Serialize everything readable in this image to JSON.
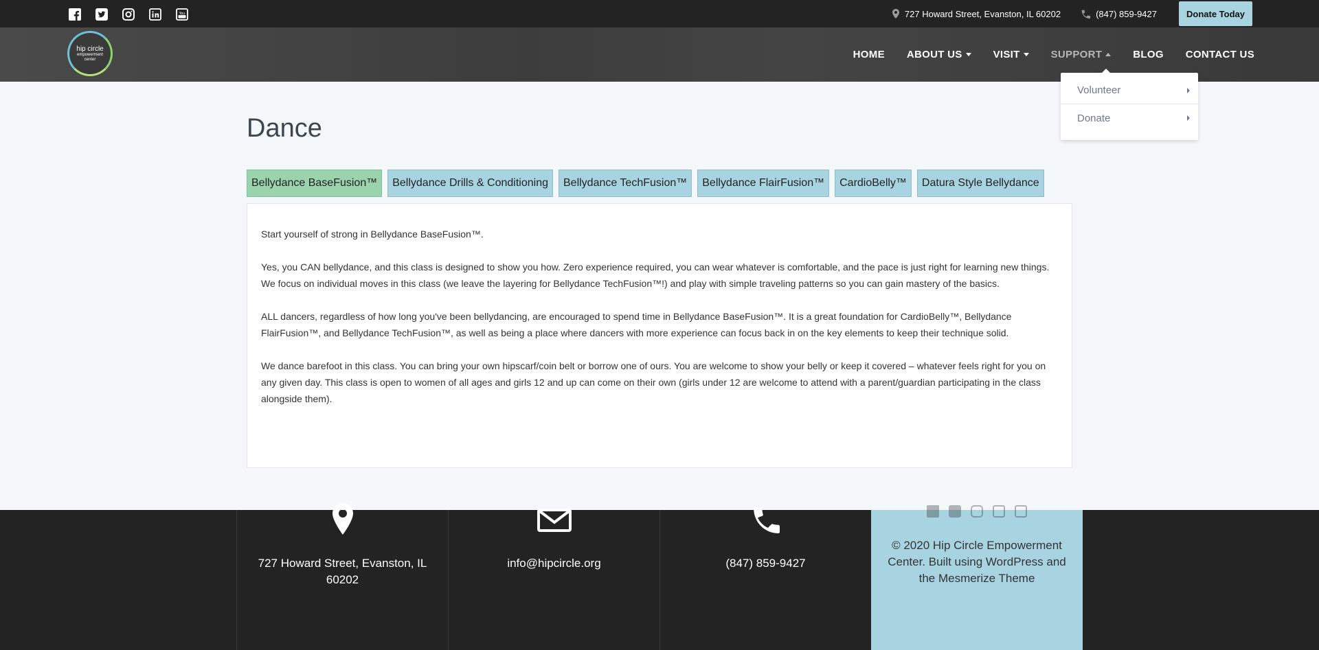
{
  "topbar": {
    "social": [
      "facebook-icon",
      "twitter-icon",
      "instagram-icon",
      "linkedin-icon",
      "youtube-icon"
    ],
    "address": "727 Howard Street, Evanston, IL 60202",
    "phone": "(847) 859-9427",
    "donate_label": "Donate Today"
  },
  "logo": {
    "line1": "hip circle",
    "line2": "empowerment",
    "line3": "center"
  },
  "nav": {
    "items": [
      {
        "label": "HOME",
        "has_caret": false
      },
      {
        "label": "ABOUT US",
        "has_caret": true
      },
      {
        "label": "VISIT",
        "has_caret": true
      },
      {
        "label": "SUPPORT",
        "has_caret": true,
        "active": true
      },
      {
        "label": "BLOG",
        "has_caret": false
      },
      {
        "label": "CONTACT US",
        "has_caret": false
      }
    ],
    "dropdown": [
      "Volunteer",
      "Donate"
    ]
  },
  "main": {
    "title": "Dance",
    "tabs": [
      "Bellydance BaseFusion™",
      "Bellydance Drills & Conditioning",
      "Bellydance TechFusion™",
      "Bellydance FlairFusion™",
      "CardioBelly™",
      "Datura Style Bellydance"
    ],
    "selected_tab": 0,
    "paragraphs": [
      "Start yourself of strong in Bellydance BaseFusion™.",
      "Yes, you CAN bellydance, and this class is designed to show you how. Zero experience required, you can wear whatever is comfortable, and the pace is just right for learning new things. We focus on individual moves in this class (we leave the layering for Bellydance TechFusion™!) and play with simple traveling patterns so you can gain mastery of the basics.",
      "ALL dancers, regardless of how long you've been bellydancing, are encouraged to spend time in Bellydance BaseFusion™. It is a great foundation for CardioBelly™, Bellydance FlairFusion™, and Bellydance TechFusion™, as well as being a place where dancers with more experience can focus back in on the key elements to keep their technique solid.",
      "We dance barefoot in this class. You can bring your own hipscarf/coin belt or borrow one of ours. You are welcome to show your belly or keep it covered – whatever feels right for you on any given day. This class is open to women of all ages and girls 12 and up can come on their own (girls under 12 are welcome to attend with a parent/guardian participating in the class alongside them)."
    ]
  },
  "footer": {
    "address": "727 Howard Street, Evanston, IL 60202",
    "email": "info@hipcircle.org",
    "phone": "(847) 859-9427",
    "copyright": "© 2020 Hip Circle Empowerment Center. Built using WordPress and the Mesmerize Theme"
  },
  "colors": {
    "accent": "#a8d4e2",
    "selected_tab": "#9bd3ad",
    "dark": "#232323"
  }
}
